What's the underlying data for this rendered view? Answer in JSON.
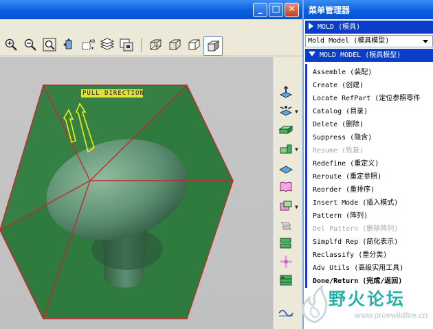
{
  "window": {
    "minimize_glyph": "_",
    "maximize_glyph": "□",
    "close_glyph": "✕"
  },
  "toolbar": {
    "icons": [
      "zoom-in-icon",
      "zoom-out-icon",
      "zoom-fit-icon",
      "orient-icon",
      "saved-views-icon",
      "layers-icon",
      "view-manager-icon",
      "wireframe-icon",
      "hidden-line-icon",
      "no-hidden-icon",
      "shading-icon"
    ]
  },
  "viewport": {
    "annotation": "PULL DIRECTION",
    "colors": {
      "box_fill": "#2f7a3f",
      "box_edge": "#c42828",
      "part": "#6a9a80",
      "arrow": "#f2f200"
    }
  },
  "menu_manager": {
    "title": "菜单管理器",
    "header_mold": "MOLD (模具)",
    "combo_value": "Mold Model (模具模型)",
    "header_mold_model": "MOLD MODEL (模具模型)",
    "items": [
      {
        "label": "Assemble (装配)",
        "enabled": true
      },
      {
        "label": "Create (创建)",
        "enabled": true
      },
      {
        "label": "Locate RefPart (定位参照零件",
        "enabled": true
      },
      {
        "label": "Catalog (目录)",
        "enabled": true
      },
      {
        "label": "Delete (删除)",
        "enabled": true
      },
      {
        "label": "Suppress (隐含)",
        "enabled": true
      },
      {
        "label": "Resume (恢复)",
        "enabled": false
      },
      {
        "label": "Redefine (重定义)",
        "enabled": true
      },
      {
        "label": "Reroute (重定参照)",
        "enabled": true
      },
      {
        "label": "Reorder (重排序)",
        "enabled": true
      },
      {
        "label": "Insert Mode (插入模式)",
        "enabled": true
      },
      {
        "label": "Pattern (阵列)",
        "enabled": true
      },
      {
        "label": "Del Pattern (删除阵列)",
        "enabled": false
      },
      {
        "label": "Simplfd Rep (简化表示)",
        "enabled": true
      },
      {
        "label": "Reclassify (重分类)",
        "enabled": true
      },
      {
        "label": "Adv Utils (高级实用工具)",
        "enabled": true
      },
      {
        "label": "Done/Return (完成/返回)",
        "enabled": true,
        "bold": true
      }
    ]
  },
  "watermark": {
    "text": "野火论坛",
    "url": "www.proewildfire.cn"
  }
}
